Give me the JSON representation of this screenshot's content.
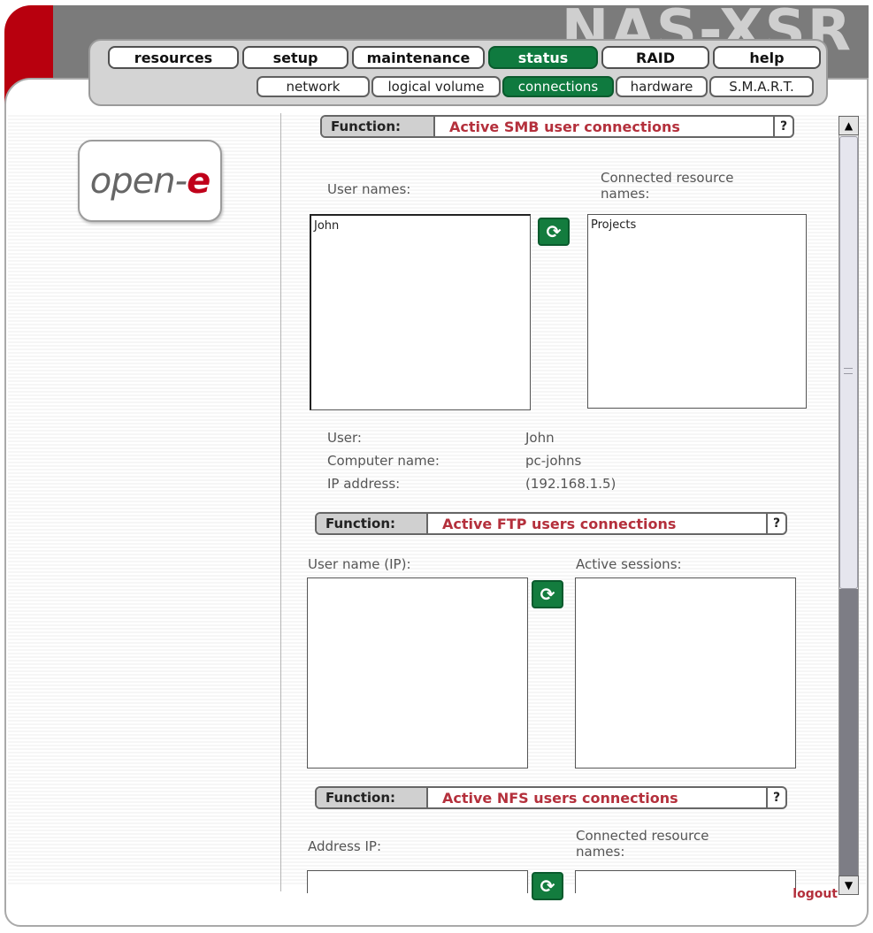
{
  "brand": "NAS-XSR",
  "nav": {
    "tabs": [
      {
        "label": "resources",
        "active": false
      },
      {
        "label": "setup",
        "active": false
      },
      {
        "label": "maintenance",
        "active": false
      },
      {
        "label": "status",
        "active": true
      },
      {
        "label": "RAID",
        "active": false
      },
      {
        "label": "help",
        "active": false
      }
    ],
    "subtabs": [
      {
        "label": "network",
        "active": false
      },
      {
        "label": "logical volume",
        "active": false
      },
      {
        "label": "connections",
        "active": true
      },
      {
        "label": "hardware",
        "active": false
      },
      {
        "label": "S.M.A.R.T.",
        "active": false
      }
    ]
  },
  "logo": {
    "prefix": "open-",
    "suffix": "e"
  },
  "smb": {
    "function_label": "Function:",
    "title": "Active SMB user connections",
    "help": "?",
    "users_label": "User names:",
    "resources_label_1": "Connected resource",
    "resources_label_2": "names:",
    "users": [
      "John"
    ],
    "resources": [
      "Projects"
    ],
    "details": {
      "user_label": "User:",
      "user_value": "John",
      "computer_label": "Computer name:",
      "computer_value": "pc-johns",
      "ip_label": "IP address:",
      "ip_value": "(192.168.1.5)"
    }
  },
  "ftp": {
    "function_label": "Function:",
    "title": "Active FTP users connections",
    "help": "?",
    "users_label": "User name (IP):",
    "sessions_label": "Active sessions:"
  },
  "nfs": {
    "function_label": "Function:",
    "title": "Active NFS users connections",
    "help": "?",
    "address_label": "Address IP:",
    "resources_label_1": "Connected resource",
    "resources_label_2": "names:"
  },
  "icons": {
    "refresh": "refresh-icon",
    "scroll_up": "arrow-up-icon",
    "scroll_down": "arrow-down-icon"
  },
  "colors": {
    "accent_green": "#0f7a3f",
    "brand_red": "#b8000e",
    "title_red": "#b4303c"
  },
  "footer": {
    "logout": "logout"
  }
}
